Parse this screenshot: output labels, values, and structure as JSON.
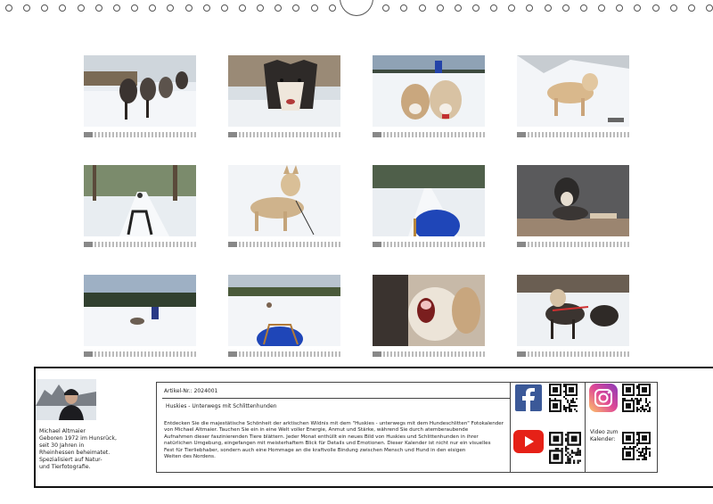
{
  "binding": {
    "ring_count": 38
  },
  "thumbnails": [
    {
      "subject": "sled-dog-team",
      "label_color": "#888888"
    },
    {
      "subject": "husky-closeup",
      "label_color": "#888888"
    },
    {
      "subject": "two-huskies-musher",
      "label_color": "#888888"
    },
    {
      "subject": "husky-in-snow",
      "label_color": "#888888"
    },
    {
      "subject": "forest-trail-sled",
      "label_color": "#888888"
    },
    {
      "subject": "husky-standing",
      "label_color": "#888888"
    },
    {
      "subject": "sled-ride-trail",
      "label_color": "#888888"
    },
    {
      "subject": "husky-on-bench",
      "label_color": "#888888"
    },
    {
      "subject": "lake-team",
      "label_color": "#888888"
    },
    {
      "subject": "frozen-lake-ride",
      "label_color": "#888888"
    },
    {
      "subject": "howling-husky",
      "label_color": "#888888"
    },
    {
      "subject": "dog-team-harness",
      "label_color": "#888888"
    }
  ],
  "author": {
    "name": "Michael Altmaier",
    "lines": [
      "Michael Altmaier",
      "Geboren 1972 im Hunsrück,",
      "seit 30 Jahren in",
      "Rheinhessen beheimatet.",
      "Spezialisiert auf Natur-",
      "und Tierfotografie."
    ]
  },
  "article": {
    "number_label": "Artikel-Nr.: 2024001",
    "title": "Huskies - Unterwegs mit Schlittenhunden",
    "description_lines": [
      "Entdecken Sie die majestätische Schönheit der arktischen Wildnis mit dem \"Huskies - unterwegs mit dem Hundeschlitten\" Fotokalender",
      "von Michael Altmaier. Tauchen Sie ein in eine Welt voller Energie, Anmut und Stärke, während Sie durch atemberaubende",
      "Aufnahmen dieser faszinierenden Tiere blättern. Jeder Monat enthüllt ein neues Bild von Huskies und Schlittenhunden in ihrer",
      "natürlichen Umgebung, eingefangen mit meisterhaftem Blick für Details und Emotionen. Dieser Kalender ist nicht nur ein visuelles",
      "Fest für Tierliebhaber, sondern auch eine Hommage an die kraftvolle Bindung zwischen Mensch und Hund in den eisigen",
      "Weiten des Nordens."
    ]
  },
  "social": {
    "facebook": {
      "icon": "facebook-icon",
      "color": "#3b5998"
    },
    "instagram": {
      "icon": "instagram-icon",
      "color": "#d6249f"
    },
    "youtube": {
      "icon": "youtube-icon",
      "color": "#e62117"
    },
    "video_label_1": "Video zum",
    "video_label_2": "Kalender:"
  }
}
